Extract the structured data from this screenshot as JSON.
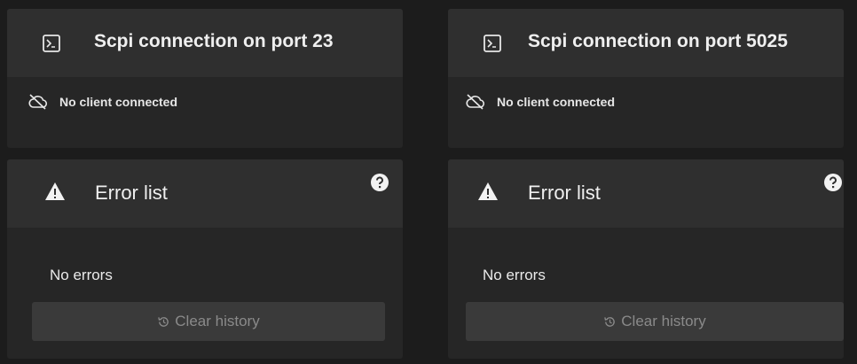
{
  "panels": [
    {
      "connection": {
        "icon": "terminal-icon",
        "title": "Scpi connection on port 23",
        "status_icon": "cloud-off-icon",
        "status": "No client connected"
      },
      "errors": {
        "icon": "warning-icon",
        "title": "Error list",
        "help_icon": "help-icon",
        "message": "No errors",
        "button_icon": "history-icon",
        "button_label": "Clear history"
      }
    },
    {
      "connection": {
        "icon": "terminal-icon",
        "title": "Scpi connection on port 5025",
        "status_icon": "cloud-off-icon",
        "status": "No client connected"
      },
      "errors": {
        "icon": "warning-icon",
        "title": "Error list",
        "help_icon": "help-icon",
        "message": "No errors",
        "button_icon": "history-icon",
        "button_label": "Clear history"
      }
    }
  ],
  "colors": {
    "background": "#1c1c1c",
    "card": "#262626",
    "card_header": "#2f2f2f",
    "button_disabled": "#3a3a3a"
  }
}
